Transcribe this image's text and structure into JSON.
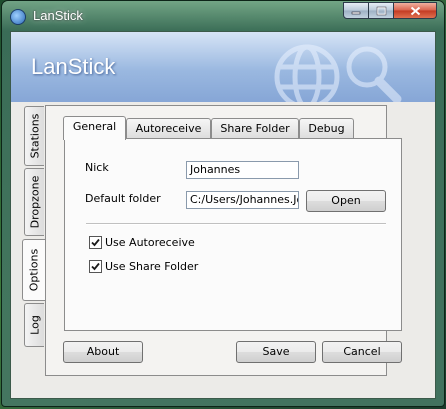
{
  "window": {
    "title": "LanStick",
    "icon": "lanstick-globe-icon",
    "caption_buttons": {
      "minimize": "minimize-icon",
      "maximize": "maximize-icon",
      "close": "close-icon"
    }
  },
  "banner": {
    "title": "LanStick",
    "logo": "globe-search-icon"
  },
  "side_tabs": [
    "Stations",
    "Dropzone",
    "Options",
    "Log"
  ],
  "active_side_tab": "Options",
  "top_tabs": [
    "General",
    "Autoreceive",
    "Share Folder",
    "Debug"
  ],
  "active_top_tab": "General",
  "general": {
    "nick_label": "Nick",
    "nick_value": "Johannes",
    "folder_label": "Default folder",
    "folder_value": "C:/Users/Johannes.Jo",
    "open_button": "Open",
    "use_autoreceive_label": "Use Autoreceive",
    "use_autoreceive_checked": true,
    "use_share_folder_label": "Use Share Folder",
    "use_share_folder_checked": true
  },
  "footer": {
    "about_button": "About",
    "save_button": "Save",
    "cancel_button": "Cancel"
  },
  "colors": {
    "banner": "#9ab8e0",
    "close": "#c23a22",
    "glass": "#4a8a6a"
  }
}
